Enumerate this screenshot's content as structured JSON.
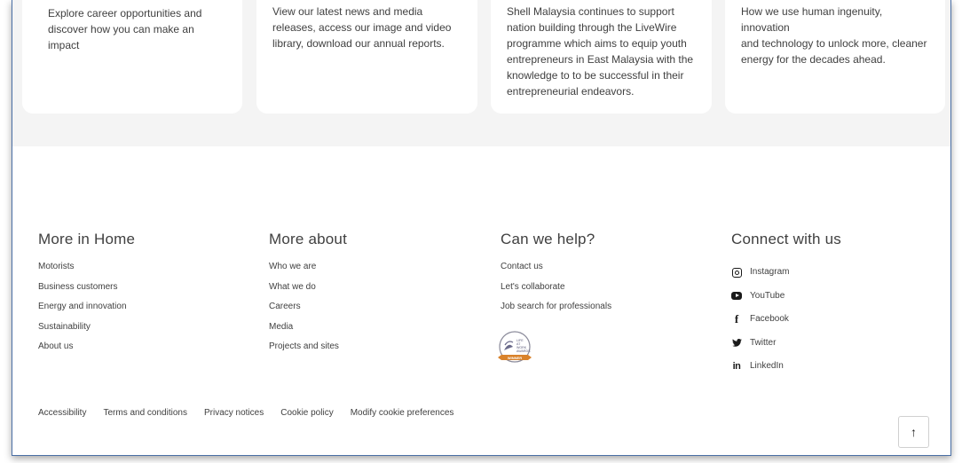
{
  "cards": [
    {
      "text": "Explore career opportunities and\ndiscover how you can make an impact"
    },
    {
      "text": "View our latest news and media\nreleases, access our image and video\nlibrary, download our annual reports."
    },
    {
      "text": "Shell Malaysia continues to support\nnation building through the LiveWire\nprogramme which aims to equip youth\nentrepreneurs in East Malaysia with the\nknowledge to to be successful in their\nentrepreneurial endeavors."
    },
    {
      "text": "How we use human ingenuity, innovation\nand technology to unlock more, cleaner\nenergy for the decades ahead."
    }
  ],
  "footer": {
    "more_in_home": {
      "title": "More in Home",
      "links": [
        "Motorists",
        "Business customers",
        "Energy and innovation",
        "Sustainability",
        "About us"
      ]
    },
    "more_about": {
      "title": "More about",
      "links": [
        "Who we are",
        "What we do",
        "Careers",
        "Media",
        "Projects and sites"
      ]
    },
    "can_we_help": {
      "title": "Can we help?",
      "links": [
        "Contact us",
        "Let's collaborate",
        "Job search for professionals"
      ]
    },
    "connect": {
      "title": "Connect with us",
      "links": [
        {
          "label": "Instagram",
          "icon": "instagram-icon"
        },
        {
          "label": "YouTube",
          "icon": "youtube-icon"
        },
        {
          "label": "Facebook",
          "icon": "facebook-icon"
        },
        {
          "label": "Twitter",
          "icon": "twitter-icon"
        },
        {
          "label": "LinkedIn",
          "icon": "linkedin-icon"
        }
      ]
    },
    "award": {
      "line1": "LIFE",
      "line2": "AT",
      "line3": "WORK",
      "line4": "AWARDS",
      "ribbon": "WINNER"
    },
    "bottom_links": [
      "Accessibility",
      "Terms and conditions",
      "Privacy notices",
      "Cookie policy",
      "Modify cookie preferences"
    ],
    "back_to_top": "↑"
  },
  "colors": {
    "accent_gold": "#d9822b",
    "text": "#404040",
    "frame_border": "#4a6fa5"
  }
}
